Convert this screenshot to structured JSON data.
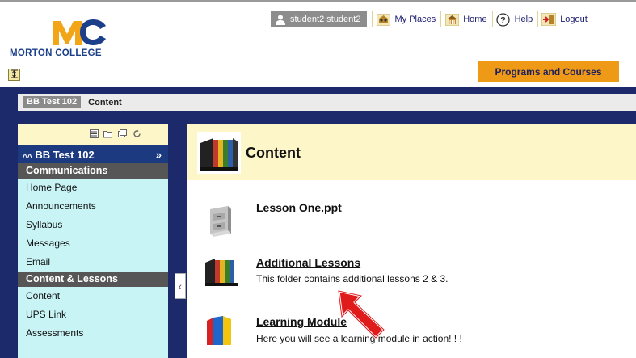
{
  "header": {
    "logo_text": "MORTON COLLEGE",
    "user_name": "student2 student2",
    "nav": [
      {
        "label": "My Places",
        "icon": "my-places-icon"
      },
      {
        "label": "Home",
        "icon": "home-icon"
      },
      {
        "label": "Help",
        "icon": "help-icon"
      },
      {
        "label": "Logout",
        "icon": "logout-icon"
      }
    ],
    "programs_tab": "Programs and Courses"
  },
  "breadcrumb": {
    "course": "BB Test 102",
    "page": "Content"
  },
  "sidebar": {
    "course_title": "BB Test 102",
    "expand_glyph": "»",
    "collapse_glyph": "‹",
    "sections": [
      {
        "heading": "Communications",
        "items": [
          "Home Page",
          "Announcements",
          "Syllabus",
          "Messages",
          "Email"
        ]
      },
      {
        "heading": "Content & Lessons",
        "items": [
          "Content",
          "UPS Link",
          "Assessments"
        ]
      }
    ]
  },
  "main": {
    "title": "Content",
    "items": [
      {
        "title": "Lesson One.ppt",
        "description": "",
        "icon": "file-cabinet-icon"
      },
      {
        "title": "Additional Lessons",
        "description": "This folder contains additional lessons 2 & 3.",
        "icon": "folder-organizer-icon"
      },
      {
        "title": "Learning Module",
        "description": "Here you will see a learning module in action! ! !",
        "icon": "learning-module-icon"
      }
    ]
  },
  "colors": {
    "frame_blue": "#1c2a6b",
    "programs_orange": "#ef9a16",
    "sidebar_cyan": "#c9f4f6",
    "header_cream": "#fdf6c9",
    "annotation_arrow_red": "#e01b1b"
  }
}
